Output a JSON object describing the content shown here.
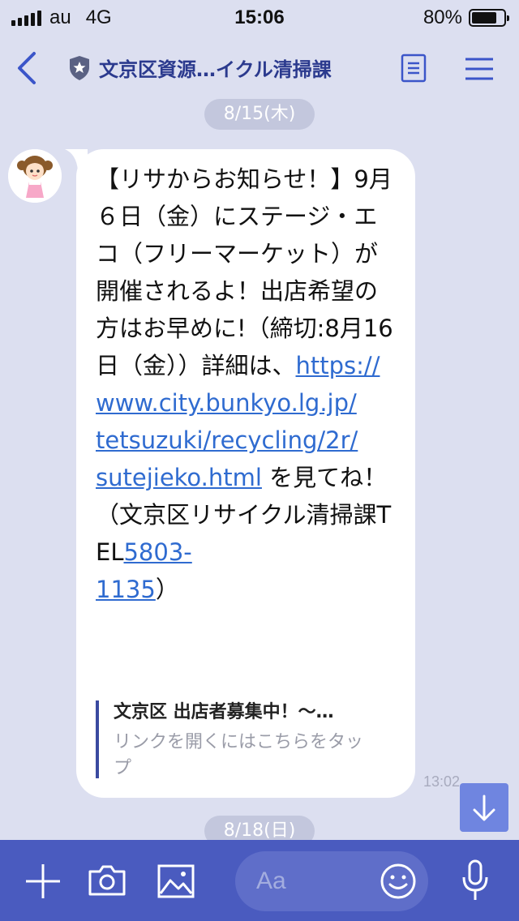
{
  "status": {
    "carrier": "au",
    "network": "4G",
    "time": "15:06",
    "battery": "80%",
    "battery_level": 0.8
  },
  "header": {
    "title": "文京区資源…イクル清掃課"
  },
  "dates": {
    "first": "8/15(木)",
    "second": "8/18(日)"
  },
  "message": {
    "text_before_link": "【リサからお知らせ！】9月６日（金）にステージ・エコ（フリーマーケット）が開催されるよ！出店希望の方はお早めに!（締切:8月16日（金））詳細は、",
    "url_line1": "https://",
    "url_line2": "www.city.bunkyo.lg.jp/",
    "url_line3": "tetsuzuki/recycling/2r/",
    "url_line4": "sutejieko.html",
    "text_after_link": " を見てね！（文京区リサイクル清掃課TEL",
    "phone_part1": "5803-",
    "phone_part2": "1135",
    "text_end": "）",
    "time": "13:02"
  },
  "link_preview": {
    "title": "文京区 出店者募集中！〜…",
    "subtitle": "リンクを開くにはこちらをタップ"
  },
  "input": {
    "placeholder": "Aa"
  },
  "colors": {
    "background": "#dcdff0",
    "header_title": "#2b3a8e",
    "link": "#2f6bd0",
    "bottom_bar": "#4a5bbf"
  }
}
